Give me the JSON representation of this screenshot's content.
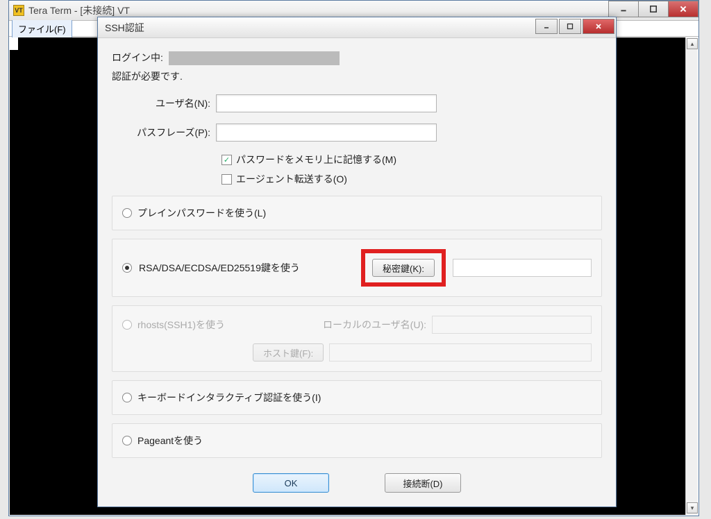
{
  "parent_window": {
    "icon_text": "VT",
    "title": "Tera Term - [未接続] VT"
  },
  "menubar": {
    "file": "ファイル(F)"
  },
  "dialog": {
    "title": "SSH認証",
    "login_prefix": "ログイン中:",
    "auth_required": "認証が必要です.",
    "username_label": "ユーザ名(N):",
    "username_value": "",
    "passphrase_label": "パスフレーズ(P):",
    "passphrase_value": "",
    "check_remember": "パスワードをメモリ上に記憶する(M)",
    "check_agent_fwd": "エージェント転送する(O)",
    "radio_plain": "プレインパスワードを使う(L)",
    "radio_rsa": "RSA/DSA/ECDSA/ED25519鍵を使う",
    "btn_private_key": "秘密鍵(K):",
    "radio_rhosts": "rhosts(SSH1)を使う",
    "local_user_label": "ローカルのユーザ名(U):",
    "btn_host_key": "ホスト鍵(F):",
    "radio_keyboard": "キーボードインタラクティブ認証を使う(I)",
    "radio_pageant": "Pageantを使う",
    "btn_ok": "OK",
    "btn_disconnect": "接続断(D)"
  }
}
